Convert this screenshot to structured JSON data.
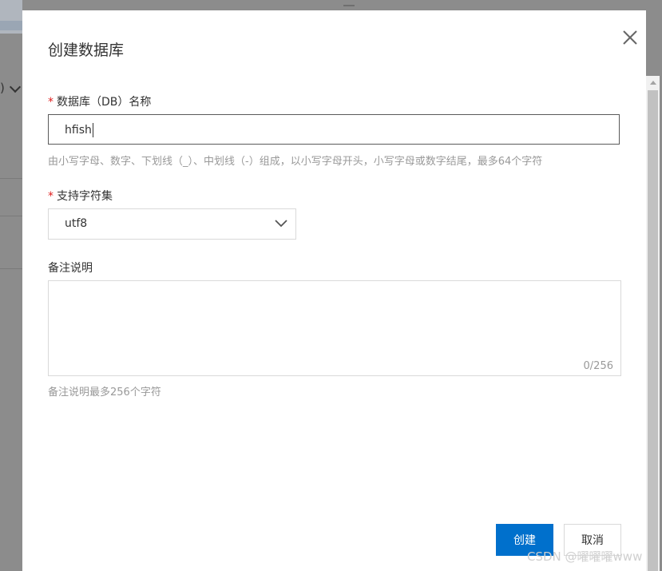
{
  "dialog": {
    "title": "创建数据库",
    "db_name": {
      "required_mark": "*",
      "label": "数据库（DB）名称",
      "value": "hfish",
      "hint": "由小写字母、数字、下划线（_）、中划线（-）组成，以小写字母开头，小写字母或数字结尾，最多64个字符"
    },
    "charset": {
      "required_mark": "*",
      "label": "支持字符集",
      "selected": "utf8"
    },
    "remark": {
      "label": "备注说明",
      "value": "",
      "counter": "0/256",
      "hint": "备注说明最多256个字符"
    },
    "buttons": {
      "create": "创建",
      "cancel": "取消"
    }
  },
  "background": {
    "paren_text": ")"
  },
  "watermark": "CSDN @曜曜曜www",
  "colors": {
    "primary": "#0070cc",
    "required": "#e02020",
    "hint": "#999999",
    "overlay": "#8c8c8c"
  }
}
